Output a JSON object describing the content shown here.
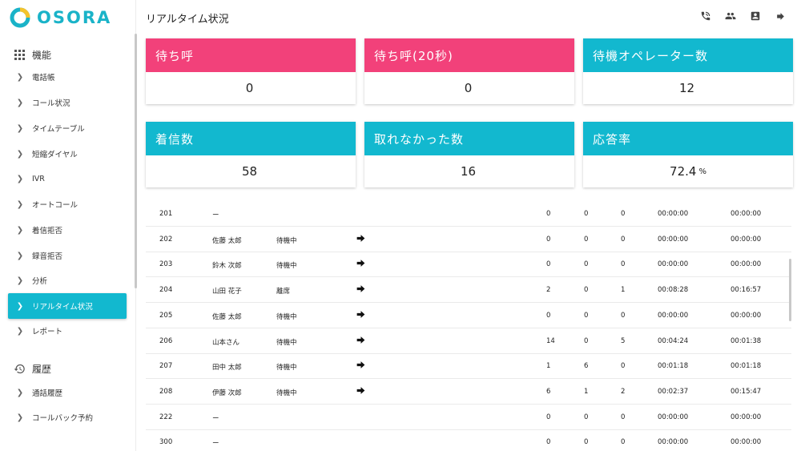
{
  "brand": {
    "name": "OSORA",
    "accent": "#12b8cf",
    "pink": "#f2417a"
  },
  "header": {
    "title": "リアルタイム状況",
    "icons": [
      "phone-icon",
      "users-icon",
      "contact-card-icon",
      "forward-arrow-icon"
    ]
  },
  "sidebar": {
    "section_features": "機能",
    "items": [
      {
        "label": "電話帳"
      },
      {
        "label": "コール状況"
      },
      {
        "label": "タイムテーブル"
      },
      {
        "label": "短縮ダイヤル"
      },
      {
        "label": "IVR"
      },
      {
        "label": "オートコール"
      },
      {
        "label": "着信拒否"
      },
      {
        "label": "録音拒否"
      },
      {
        "label": "分析"
      },
      {
        "label": "リアルタイム状況",
        "active": true
      },
      {
        "label": "レポート"
      }
    ],
    "section_history": "履歴",
    "history_items": [
      {
        "label": "通話履歴"
      },
      {
        "label": "コールバック予約"
      }
    ]
  },
  "cards": [
    {
      "title": "待ち呼",
      "value": "0",
      "unit": "",
      "color": "pink"
    },
    {
      "title": "待ち呼(20秒)",
      "value": "0",
      "unit": "",
      "color": "pink"
    },
    {
      "title": "待機オペレーター数",
      "value": "12",
      "unit": "",
      "color": "cyan"
    },
    {
      "title": "着信数",
      "value": "58",
      "unit": "",
      "color": "cyan"
    },
    {
      "title": "取れなかった数",
      "value": "16",
      "unit": "",
      "color": "cyan"
    },
    {
      "title": "応答率",
      "value": "72.4",
      "unit": "%",
      "color": "cyan"
    }
  ],
  "table": {
    "rows": [
      {
        "ext": "201",
        "name": "ー",
        "status": "",
        "action": false,
        "n1": "0",
        "n2": "0",
        "n3": "0",
        "t1": "00:00:00",
        "t2": "00:00:00"
      },
      {
        "ext": "202",
        "name": "佐藤 太郎",
        "status": "待機中",
        "action": true,
        "n1": "0",
        "n2": "0",
        "n3": "0",
        "t1": "00:00:00",
        "t2": "00:00:00"
      },
      {
        "ext": "203",
        "name": "鈴木 次郎",
        "status": "待機中",
        "action": true,
        "n1": "0",
        "n2": "0",
        "n3": "0",
        "t1": "00:00:00",
        "t2": "00:00:00"
      },
      {
        "ext": "204",
        "name": "山田 花子",
        "status": "離席",
        "action": true,
        "n1": "2",
        "n2": "0",
        "n3": "1",
        "t1": "00:08:28",
        "t2": "00:16:57"
      },
      {
        "ext": "205",
        "name": "佐藤 太郎",
        "status": "待機中",
        "action": true,
        "n1": "0",
        "n2": "0",
        "n3": "0",
        "t1": "00:00:00",
        "t2": "00:00:00"
      },
      {
        "ext": "206",
        "name": "山本さん",
        "status": "待機中",
        "action": true,
        "n1": "14",
        "n2": "0",
        "n3": "5",
        "t1": "00:04:24",
        "t2": "00:01:38"
      },
      {
        "ext": "207",
        "name": "田中 太郎",
        "status": "待機中",
        "action": true,
        "n1": "1",
        "n2": "6",
        "n3": "0",
        "t1": "00:01:18",
        "t2": "00:01:18"
      },
      {
        "ext": "208",
        "name": "伊藤 次郎",
        "status": "待機中",
        "action": true,
        "n1": "6",
        "n2": "1",
        "n3": "2",
        "t1": "00:02:37",
        "t2": "00:15:47"
      },
      {
        "ext": "222",
        "name": "ー",
        "status": "",
        "action": false,
        "n1": "0",
        "n2": "0",
        "n3": "0",
        "t1": "00:00:00",
        "t2": "00:00:00"
      },
      {
        "ext": "300",
        "name": "ー",
        "status": "",
        "action": false,
        "n1": "0",
        "n2": "0",
        "n3": "0",
        "t1": "00:00:00",
        "t2": "00:00:00"
      }
    ]
  }
}
